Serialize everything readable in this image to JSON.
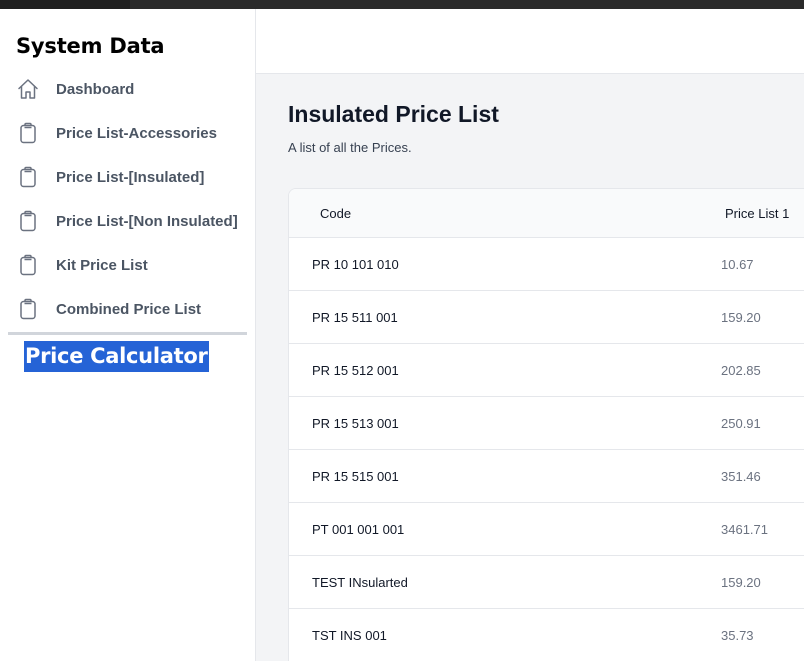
{
  "sidebar": {
    "title": "System Data",
    "items": [
      {
        "label": "Dashboard",
        "icon": "home-icon"
      },
      {
        "label": "Price List-Accessories",
        "icon": "clipboard-icon"
      },
      {
        "label": "Price List-[Insulated]",
        "icon": "clipboard-icon"
      },
      {
        "label": "Price List-[Non Insulated]",
        "icon": "clipboard-icon"
      },
      {
        "label": "Kit Price List",
        "icon": "clipboard-icon"
      },
      {
        "label": "Combined Price List",
        "icon": "clipboard-icon"
      }
    ],
    "calculator_label": "Price Calculator"
  },
  "main": {
    "title": "Insulated Price List",
    "subtitle": "A list of all the Prices."
  },
  "table": {
    "headers": {
      "code": "Code",
      "price": "Price List 1"
    },
    "rows": [
      {
        "code": "PR 10 101 010",
        "price": "10.67"
      },
      {
        "code": "PR 15 511 001",
        "price": "159.20"
      },
      {
        "code": "PR 15 512 001",
        "price": "202.85"
      },
      {
        "code": "PR 15 513 001",
        "price": "250.91"
      },
      {
        "code": "PR 15 515 001",
        "price": "351.46"
      },
      {
        "code": "PT 001 001 001",
        "price": "3461.71"
      },
      {
        "code": "TEST INsularted",
        "price": "159.20"
      },
      {
        "code": "TST INS 001",
        "price": "35.73"
      }
    ]
  },
  "colors": {
    "highlight": "#2563d6",
    "icon_stroke": "#6b7280",
    "main_bg": "#f3f4f6"
  }
}
